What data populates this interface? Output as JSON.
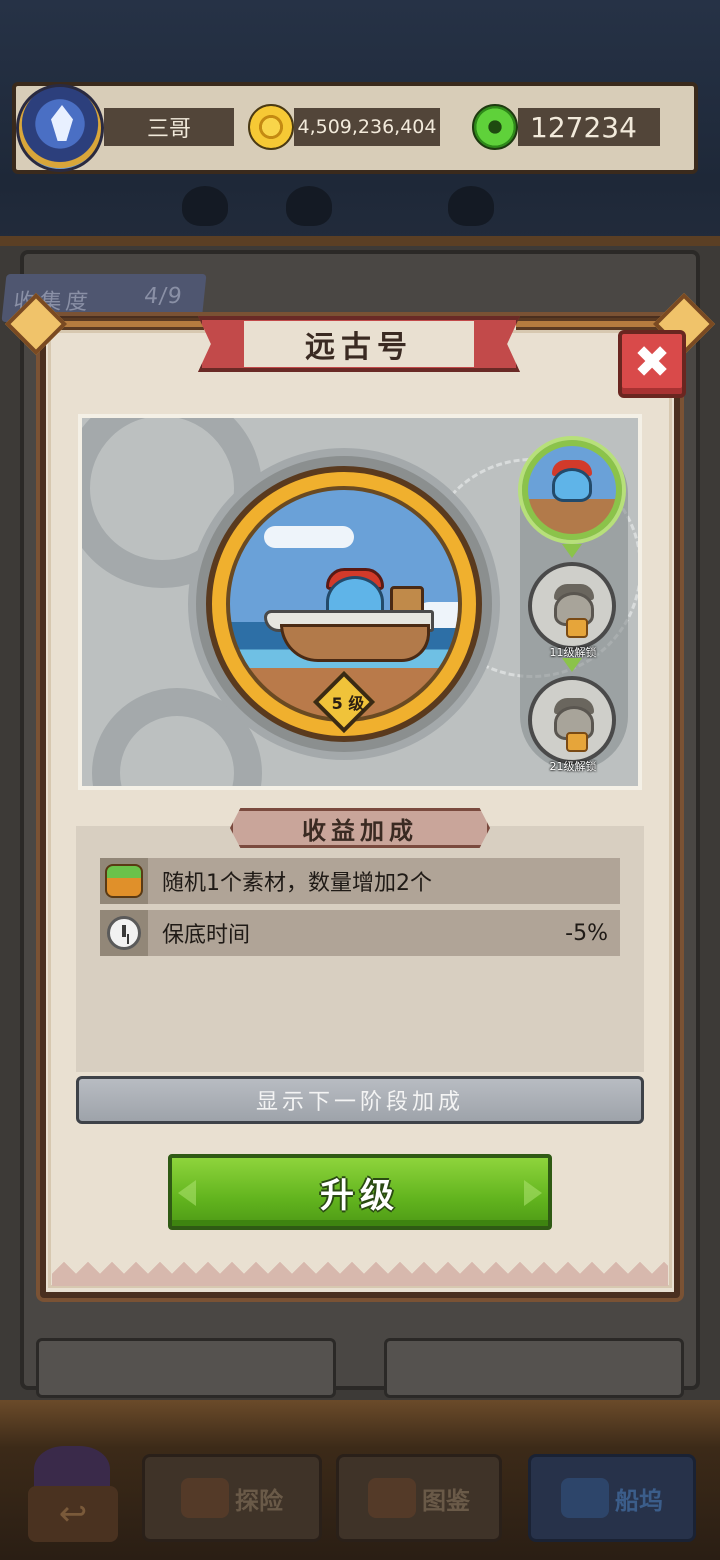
{
  "hud": {
    "player_name": "三哥",
    "gold": "4,509,236,404",
    "gems": "127234"
  },
  "collection": {
    "label": "收集度",
    "count": "4/9"
  },
  "dialog": {
    "title": "远古号",
    "close_label": "✖",
    "level_label": "5 级",
    "stages": [
      {
        "state": "current"
      },
      {
        "state": "locked",
        "unlock_label": "11级解锁"
      },
      {
        "state": "locked",
        "unlock_label": "21级解锁"
      }
    ],
    "bonus_title": "收益加成",
    "bonuses": [
      {
        "icon": "basket-icon",
        "text": "随机1个素材，数量增加2个",
        "value": ""
      },
      {
        "icon": "clock-icon",
        "text": "保底时间",
        "value": "-5%"
      }
    ],
    "next_stage_label": "显示下一阶段加成",
    "upgrade_label": "升级"
  },
  "bottom_nav": {
    "back_icon": "back-arrow-icon",
    "items": [
      {
        "label": "探险",
        "active": false
      },
      {
        "label": "图鉴",
        "active": false
      },
      {
        "label": "船坞",
        "active": true
      }
    ]
  },
  "colors": {
    "accent_green": "#62b41e",
    "close_red": "#d94a4a",
    "banner_red": "#c24a4a",
    "active_stage_ring": "#8bc34a"
  }
}
